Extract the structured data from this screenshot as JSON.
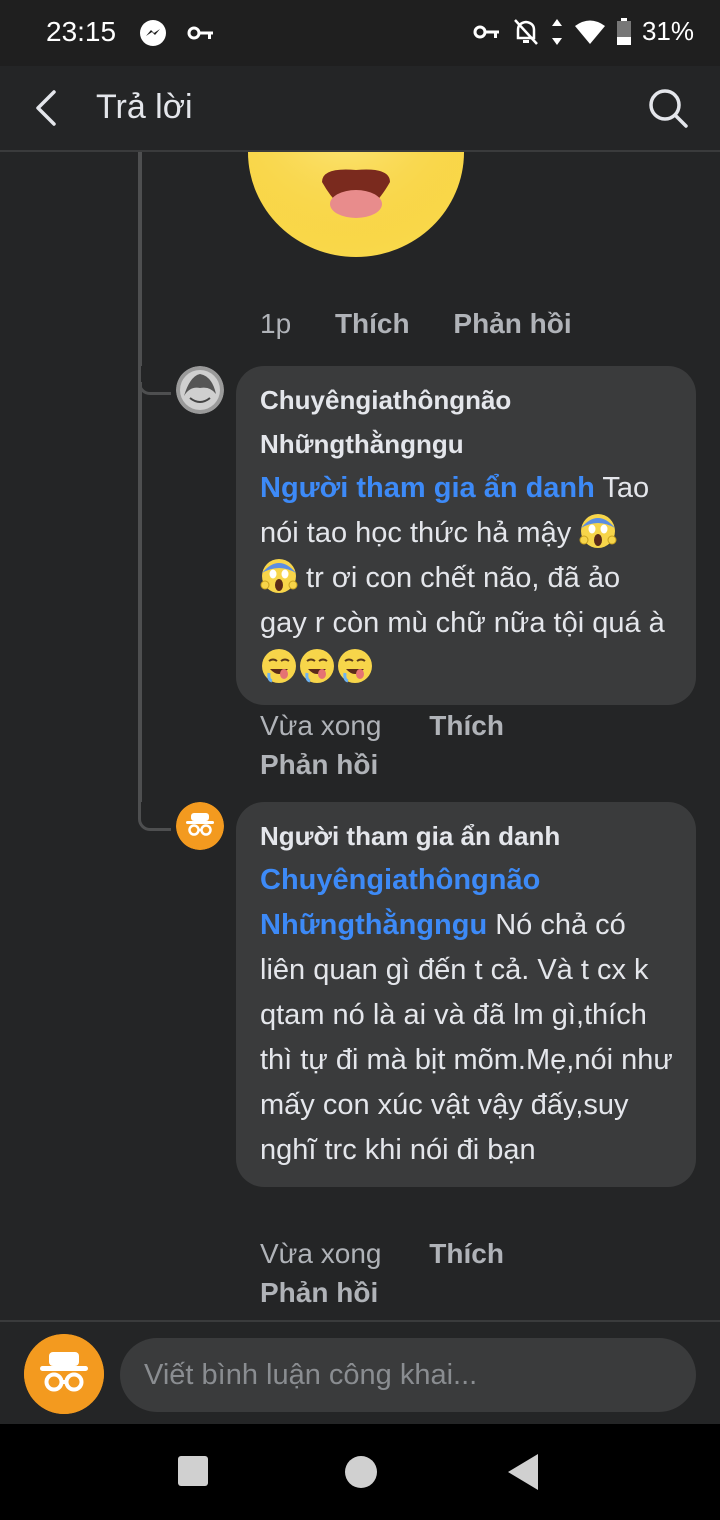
{
  "status_bar": {
    "time": "23:15",
    "battery": "31%",
    "icons": [
      "messenger-icon",
      "key-icon",
      "vpn-key-icon",
      "notifications-off-icon",
      "data-arrows-icon",
      "wifi-icon",
      "battery-icon"
    ]
  },
  "app_bar": {
    "title": "Trả lời",
    "back_icon": "back-arrow-icon",
    "search_icon": "search-icon"
  },
  "sticker_comment": {
    "time": "1p",
    "like_label": "Thích",
    "reply_label": "Phản hồi"
  },
  "comments": [
    {
      "author": "Chuyêngiathôngnão Nhữngthằngngu",
      "mention": "Người tham gia ẩn danh",
      "text": " Tao nói tao học thức hả mậy ",
      "text2": " tr ơi con chết não, đã ảo gay r còn mù chữ nữa tội quá à ",
      "emojis": [
        "face-screaming-in-fear",
        "face-screaming-in-fear",
        "drooling-face",
        "drooling-face",
        "drooling-face"
      ],
      "time": "Vừa xong",
      "like_label": "Thích",
      "reply_label": "Phản hồi"
    },
    {
      "author": "Người tham gia ẩn danh",
      "mention": "Chuyêngiathôngnão Nhữngthằngngu",
      "text": " Nó chả có liên quan gì đến t cả. Và t cx k qtam nó là ai và đã lm gì,thích thì tự đi mà bịt mõm.Mẹ,nói như mấy con xúc vật vậy đấy,suy nghĩ trc khi nói đi bạn",
      "time": "Vừa xong",
      "like_label": "Thích",
      "reply_label": "Phản hồi"
    }
  ],
  "composer": {
    "placeholder": "Viết bình luận công khai..."
  },
  "colors": {
    "background": "#242526",
    "bubble": "#3a3b3c",
    "mention": "#3d8af7",
    "anonymous_avatar": "#f39a1f"
  }
}
